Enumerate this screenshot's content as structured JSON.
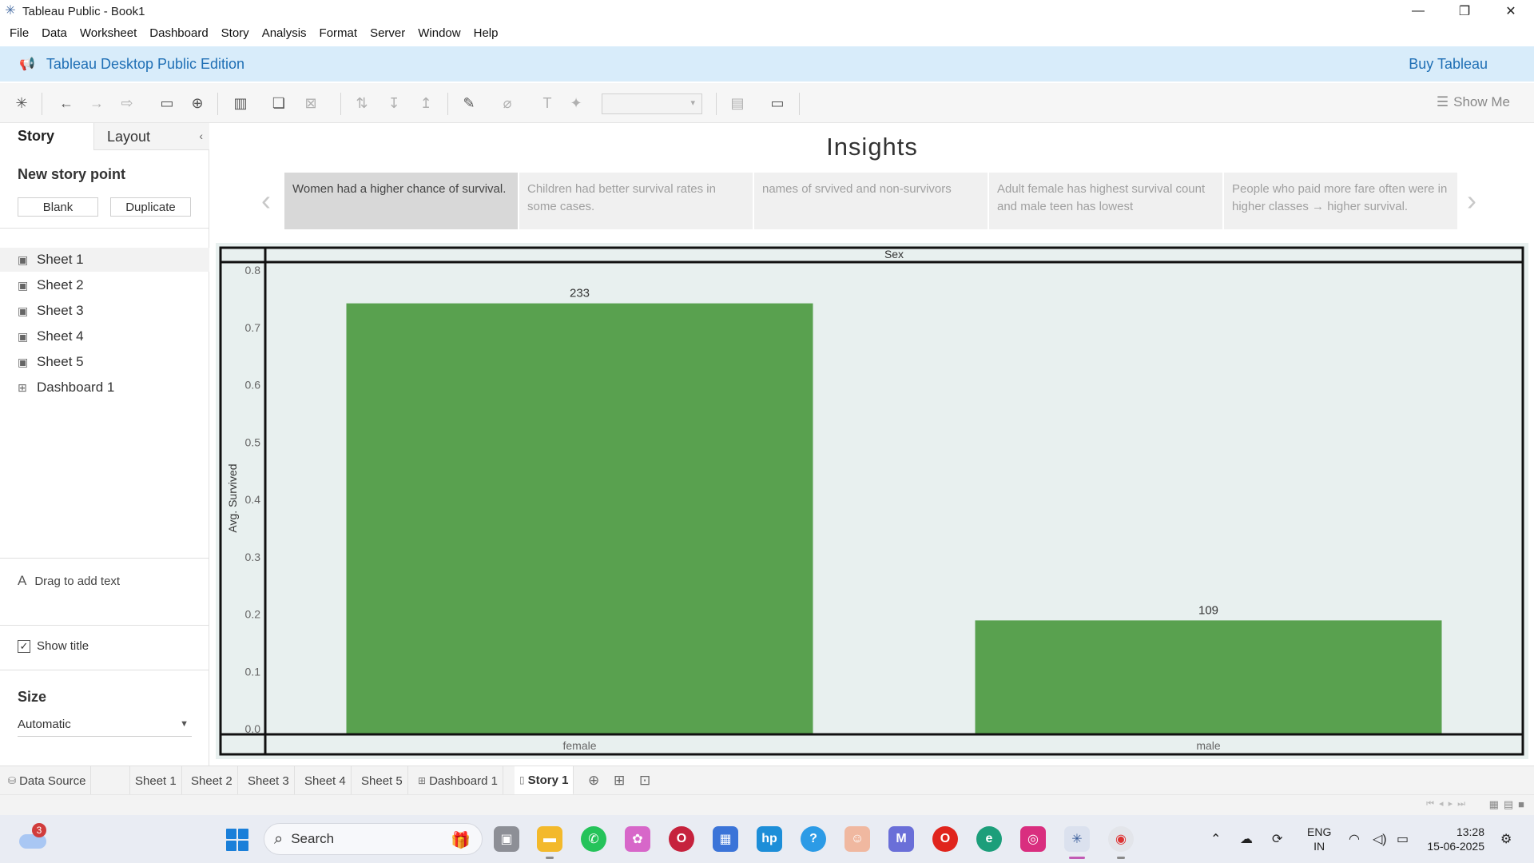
{
  "window": {
    "title": "Tableau Public - Book1",
    "controls": [
      "minimize-icon",
      "restore-icon",
      "close-icon"
    ]
  },
  "menu": [
    "File",
    "Data",
    "Worksheet",
    "Dashboard",
    "Story",
    "Analysis",
    "Format",
    "Server",
    "Window",
    "Help"
  ],
  "banner": {
    "edition": "Tableau Desktop Public Edition",
    "buy": "Buy Tableau"
  },
  "toolbar": {
    "show_me": "Show Me"
  },
  "left_pane": {
    "tab_story": "Story",
    "tab_layout": "Layout",
    "new_story_point": "New story point",
    "blank": "Blank",
    "duplicate": "Duplicate",
    "sheets": [
      {
        "name": "Sheet 1",
        "icon": "worksheet-icon"
      },
      {
        "name": "Sheet 2",
        "icon": "worksheet-icon"
      },
      {
        "name": "Sheet 3",
        "icon": "worksheet-icon"
      },
      {
        "name": "Sheet 4",
        "icon": "worksheet-icon"
      },
      {
        "name": "Sheet 5",
        "icon": "worksheet-icon"
      },
      {
        "name": "Dashboard 1",
        "icon": "dashboard-icon"
      }
    ],
    "drag_text": "Drag to add text",
    "show_title": "Show title",
    "show_title_checked": true,
    "size_title": "Size",
    "size_value": "Automatic"
  },
  "story": {
    "title": "Insights",
    "captions": [
      "Women had a higher chance of survival.",
      "Children had better survival rates in some cases.",
      "names of srvived and non-survivors",
      "Adult female has highest survival count and male teen has lowest",
      "People who paid more fare often were in higher classes → higher survival."
    ],
    "active_caption": 0
  },
  "chart_data": {
    "type": "bar",
    "title": "",
    "header": "Sex",
    "categories": [
      "female",
      "male"
    ],
    "values": [
      0.742,
      0.189
    ],
    "data_labels": [
      "233",
      "109"
    ],
    "ylabel": "Avg. Survived",
    "ylim": [
      0,
      0.8
    ],
    "yticks": [
      "0.0",
      "0.1",
      "0.2",
      "0.3",
      "0.4",
      "0.5",
      "0.6",
      "0.7",
      "0.8"
    ],
    "bar_color": "#59a14f",
    "background": "#e8f0ef"
  },
  "sheet_tabs": {
    "data_source": "Data Source",
    "tabs": [
      "Sheet 1",
      "Sheet 2",
      "Sheet 3",
      "Sheet 4",
      "Sheet 5",
      "Dashboard 1",
      "Story 1"
    ],
    "active": "Story 1"
  },
  "taskbar": {
    "weather_badge": "3",
    "search": "Search",
    "lang_line1": "ENG",
    "lang_line2": "IN",
    "time": "13:28",
    "date": "15-06-2025"
  }
}
